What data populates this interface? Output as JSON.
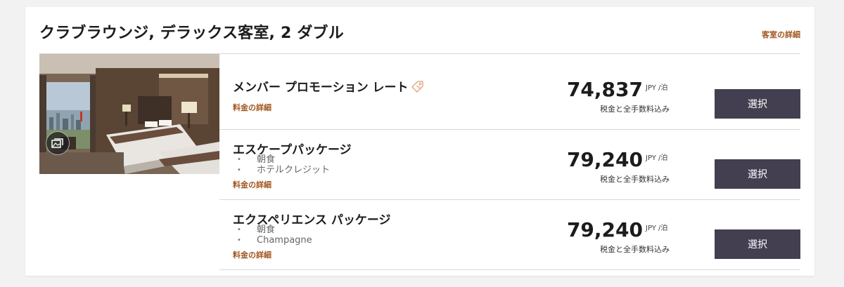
{
  "room": {
    "title": "クラブラウンジ, デラックス客室, 2 ダブル",
    "details_link": "客室の詳細"
  },
  "rates": [
    {
      "name": "メンバー プロモーション レート",
      "has_tag_icon": true,
      "inclusions": [],
      "details_link": "料金の詳細",
      "price": "74,837",
      "unit": "JPY /泊",
      "tax_note": "税金と全手数料込み",
      "select_label": "選択"
    },
    {
      "name": "エスケープパッケージ",
      "has_tag_icon": false,
      "inclusions": [
        "朝食",
        "ホテルクレジット"
      ],
      "details_link": "料金の詳細",
      "price": "79,240",
      "unit": "JPY /泊",
      "tax_note": "税金と全手数料込み",
      "select_label": "選択"
    },
    {
      "name": "エクスペリエンス パッケージ",
      "has_tag_icon": false,
      "inclusions": [
        "朝食",
        "Champagne"
      ],
      "details_link": "料金の詳細",
      "price": "79,240",
      "unit": "JPY /泊",
      "tax_note": "税金と全手数料込み",
      "select_label": "選択"
    }
  ],
  "icons": {
    "gallery": "gallery-icon",
    "tag": "price-tag-icon"
  },
  "colors": {
    "accent_link": "#a0551e",
    "button_bg": "#433f51",
    "button_text": "#ffffff",
    "divider": "#d8d8d8",
    "page_bg": "#f2f2f2"
  }
}
